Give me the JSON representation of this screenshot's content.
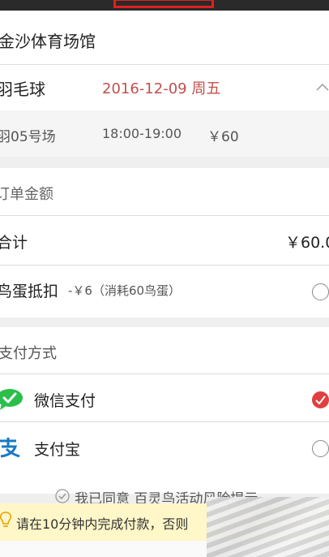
{
  "venue": {
    "name": "金沙体育场馆"
  },
  "booking": {
    "sport": "羽毛球",
    "date": "2016-12-09 周五",
    "court": "羽05号场",
    "time": "18:00-19:00",
    "price": "￥60"
  },
  "order": {
    "section_title": "订单金额",
    "total_label": "合计",
    "total_value": "￥60.0",
    "discount_label": "鸟蛋抵扣",
    "discount_detail": "-￥6（消耗60鸟蛋）"
  },
  "payment": {
    "section_title": "支付方式",
    "methods": [
      {
        "label": "微信支付",
        "icon": "wechat-icon",
        "selected": true
      },
      {
        "label": "支付宝",
        "icon": "alipay-icon",
        "selected": false
      }
    ]
  },
  "agreement": {
    "text": "我已同意 百灵鸟活动风险提示"
  },
  "notice": {
    "text": "请在10分钟内完成付款，否则"
  },
  "colors": {
    "accent": "#e0403f",
    "date": "#c0504d",
    "notice_bg": "#fff7c8"
  }
}
